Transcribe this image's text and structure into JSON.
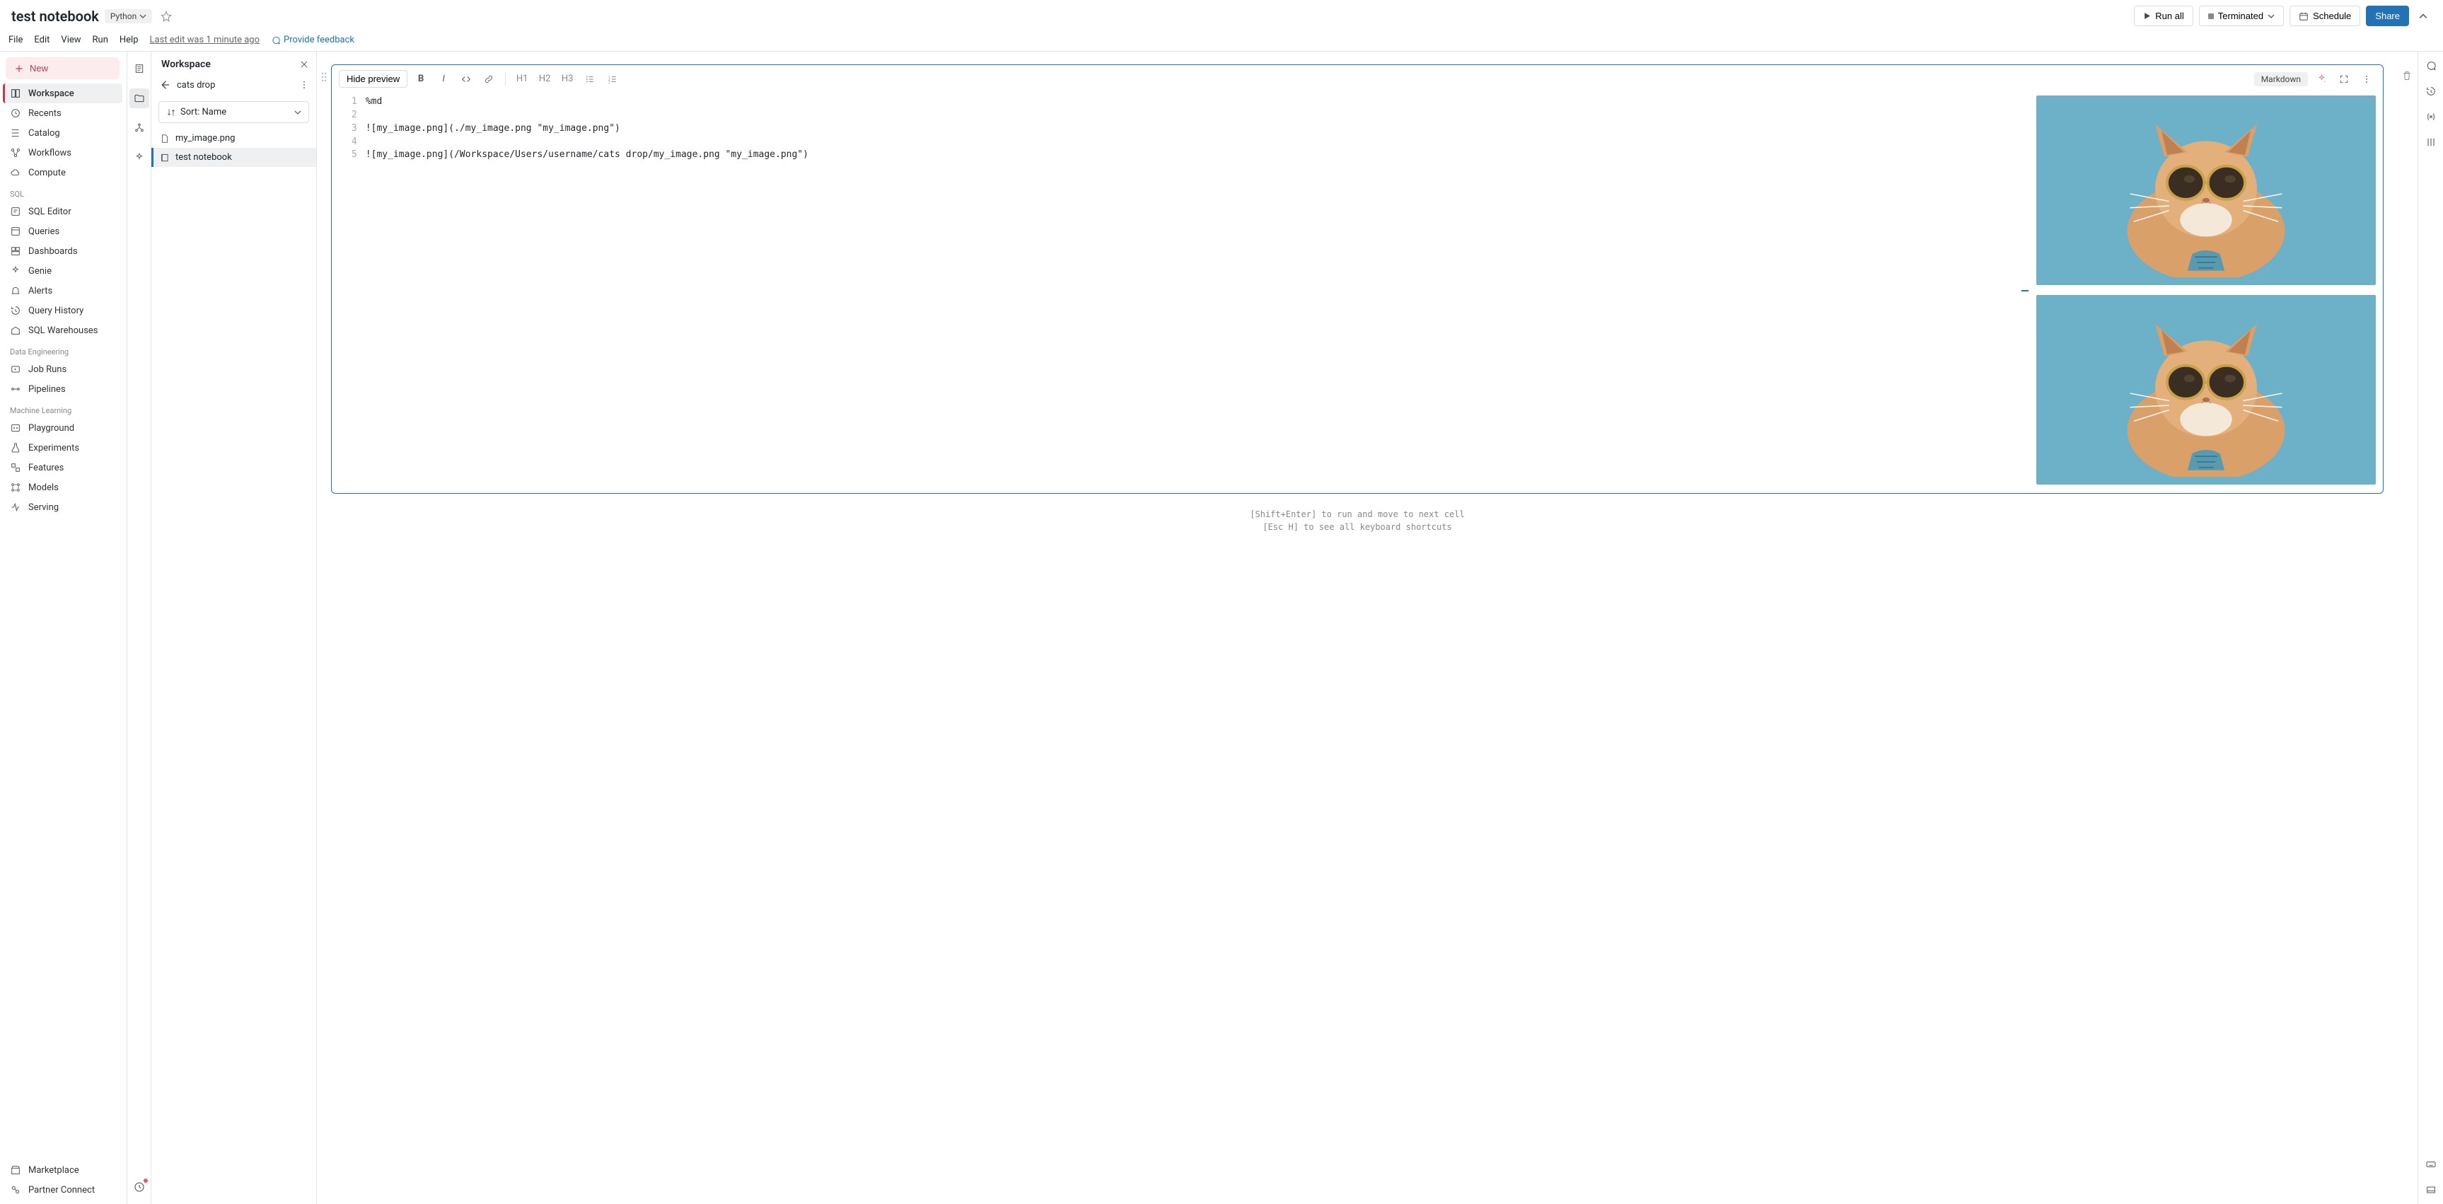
{
  "header": {
    "title": "test notebook",
    "language": "Python",
    "run_all": "Run all",
    "terminated": "Terminated",
    "schedule": "Schedule",
    "share": "Share"
  },
  "menu": {
    "file": "File",
    "edit": "Edit",
    "view": "View",
    "run": "Run",
    "help": "Help",
    "last_edit": "Last edit was 1 minute ago",
    "feedback": "Provide feedback"
  },
  "leftnav": {
    "new": "New",
    "items_top": [
      "Workspace",
      "Recents",
      "Catalog",
      "Workflows",
      "Compute"
    ],
    "section_sql": "SQL",
    "items_sql": [
      "SQL Editor",
      "Queries",
      "Dashboards",
      "Genie",
      "Alerts",
      "Query History",
      "SQL Warehouses"
    ],
    "section_de": "Data Engineering",
    "items_de": [
      "Job Runs",
      "Pipelines"
    ],
    "section_ml": "Machine Learning",
    "items_ml": [
      "Playground",
      "Experiments",
      "Features",
      "Models",
      "Serving"
    ],
    "marketplace": "Marketplace",
    "partner": "Partner Connect"
  },
  "workspace_panel": {
    "title": "Workspace",
    "folder": "cats drop",
    "sort": "Sort: Name",
    "files": [
      {
        "name": "my_image.png",
        "kind": "file"
      },
      {
        "name": "test notebook",
        "kind": "notebook"
      }
    ]
  },
  "cell": {
    "hide_preview": "Hide preview",
    "heading_h1": "H1",
    "heading_h2": "H2",
    "heading_h3": "H3",
    "type": "Markdown",
    "lines": [
      "%md",
      "",
      "![my_image.png](./my_image.png \"my_image.png\")",
      "",
      "![my_image.png](/Workspace/Users/username/cats drop/my_image.png \"my_image.png\")"
    ]
  },
  "hints": {
    "line1": "[Shift+Enter] to run and move to next cell",
    "line2": "[Esc H] to see all keyboard shortcuts"
  }
}
